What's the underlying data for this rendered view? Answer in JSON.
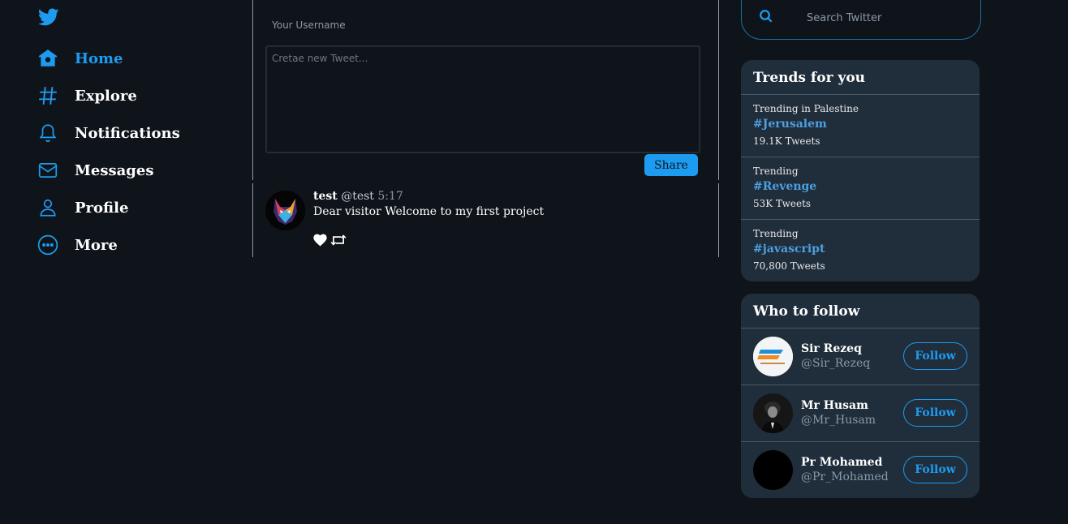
{
  "app": {
    "name": "Twitter",
    "accent": "#1d9bf0",
    "background": "#0f141a"
  },
  "nav": {
    "items": [
      {
        "label": "Home",
        "icon": "home-icon",
        "active": true
      },
      {
        "label": "Explore",
        "icon": "hashtag-icon"
      },
      {
        "label": "Notifications",
        "icon": "bell-icon"
      },
      {
        "label": "Messages",
        "icon": "mail-icon"
      },
      {
        "label": "Profile",
        "icon": "user-icon"
      },
      {
        "label": "More",
        "icon": "more-icon"
      }
    ]
  },
  "composer": {
    "username_label": "Your Username",
    "tweet_placeholder": "Cretae new Tweet...",
    "share_label": "Share"
  },
  "post": {
    "name": "test",
    "handle": "@test",
    "time": "5:17",
    "text": "Dear visitor Welcome to my first project"
  },
  "search": {
    "placeholder": "Search Twitter"
  },
  "trends": {
    "title": "Trends for you",
    "items": [
      {
        "category": "Trending in Palestine",
        "tag": "#Jerusalem",
        "count": "19.1K Tweets"
      },
      {
        "category": "Trending",
        "tag": "#Revenge",
        "count": "53K Tweets"
      },
      {
        "category": "Trending",
        "tag": "#javascript",
        "count": "70,800 Tweets"
      }
    ]
  },
  "who_to_follow": {
    "title": "Who to follow",
    "follow_label": "Follow",
    "items": [
      {
        "name": "Sir Rezeq",
        "handle": "@Sir_Rezeq"
      },
      {
        "name": "Mr Husam",
        "handle": "@Mr_Husam"
      },
      {
        "name": "Pr Mohamed",
        "handle": "@Pr_Mohamed"
      }
    ]
  }
}
